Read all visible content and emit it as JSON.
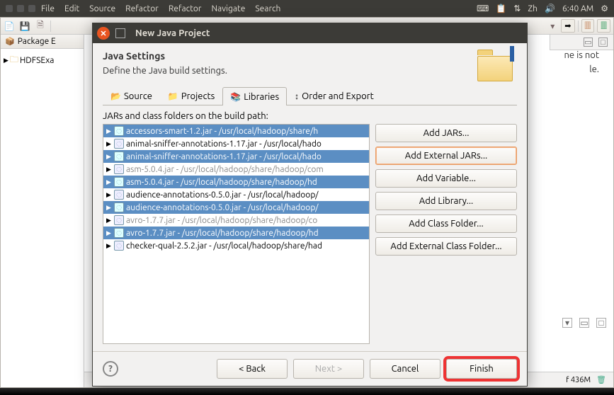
{
  "sysbar": {
    "menus": [
      "File",
      "Edit",
      "Source",
      "Refactor",
      "Refactor",
      "Navigate",
      "Search"
    ],
    "lang": "Zh",
    "time": "6:40 AM"
  },
  "eclipse": {
    "package_explorer_label": "Package E",
    "tree_item": "HDFSExa",
    "editor_msg_1": "ne is not",
    "editor_msg_2": "le.",
    "status": "f 436M"
  },
  "dialog": {
    "title": "New Java Project",
    "heading": "Java Settings",
    "sub": "Define the Java build settings.",
    "tabs": {
      "source": "Source",
      "projects": "Projects",
      "libraries": "Libraries",
      "order": "Order and Export"
    },
    "list_caption": "JARs and class folders on the build path:",
    "jars": [
      {
        "t": "accessors-smart-1.2.jar - /usr/local/hadoop/share/h",
        "sel": true
      },
      {
        "t": "animal-sniffer-annotations-1.17.jar - /usr/local/hado",
        "sel": false
      },
      {
        "t": "animal-sniffer-annotations-1.17.jar - /usr/local/hado",
        "sel": true
      },
      {
        "t": "asm-5.0.4.jar - /usr/local/hadoop/share/hadoop/com",
        "sel": false,
        "color": "gray"
      },
      {
        "t": "asm-5.0.4.jar - /usr/local/hadoop/share/hadoop/hd",
        "sel": true
      },
      {
        "t": "audience-annotations-0.5.0.jar - /usr/local/hadoop/",
        "sel": false
      },
      {
        "t": "audience-annotations-0.5.0.jar - /usr/local/hadoop/",
        "sel": true
      },
      {
        "t": "avro-1.7.7.jar - /usr/local/hadoop/share/hadoop/co",
        "sel": false,
        "color": "gray"
      },
      {
        "t": "avro-1.7.7.jar - /usr/local/hadoop/share/hadoop/hd",
        "sel": true
      },
      {
        "t": "checker-qual-2.5.2.jar - /usr/local/hadoop/share/had",
        "sel": false
      }
    ],
    "buttons": {
      "add_jars": "Add JARs...",
      "add_ext_jars": "Add External JARs...",
      "add_var": "Add Variable...",
      "add_lib": "Add Library...",
      "add_class": "Add Class Folder...",
      "add_ext_class": "Add External Class Folder..."
    },
    "footer": {
      "back": "< Back",
      "next": "Next >",
      "cancel": "Cancel",
      "finish": "Finish"
    }
  }
}
